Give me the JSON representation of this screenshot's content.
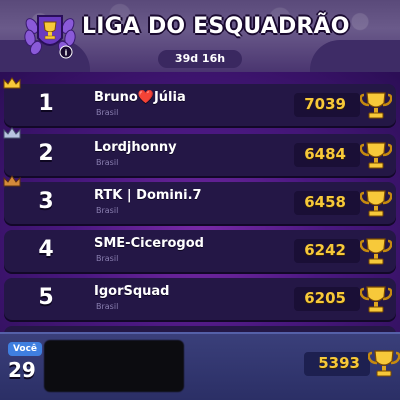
{
  "league": {
    "title": "LIGA DO ESQUADRÃO",
    "timer": "39d 16h"
  },
  "leaderboard": [
    {
      "rank": "1",
      "name": "Bruno❤️Júlia",
      "region": "Brasil",
      "score": "7039",
      "crown": "gold"
    },
    {
      "rank": "2",
      "name": "Lordjhonny",
      "region": "Brasil",
      "score": "6484",
      "crown": "silver"
    },
    {
      "rank": "3",
      "name": "RTK | Domini.7",
      "region": "Brasil",
      "score": "6458",
      "crown": "bronze"
    },
    {
      "rank": "4",
      "name": "SME-Cicerogod",
      "region": "Brasil",
      "score": "6242",
      "crown": ""
    },
    {
      "rank": "5",
      "name": "IgorSquad",
      "region": "Brasil",
      "score": "6205",
      "crown": ""
    }
  ],
  "you": {
    "label": "Você",
    "rank": "29",
    "score": "5393"
  },
  "icons": {
    "badge": "league-badge-icon",
    "trophy": "trophy-icon",
    "crown": "crown-icon"
  },
  "colors": {
    "gold": "#f7c93a",
    "silver": "#b8c4e0",
    "bronze": "#d48a3a",
    "you_label": "#3f7fe0"
  }
}
